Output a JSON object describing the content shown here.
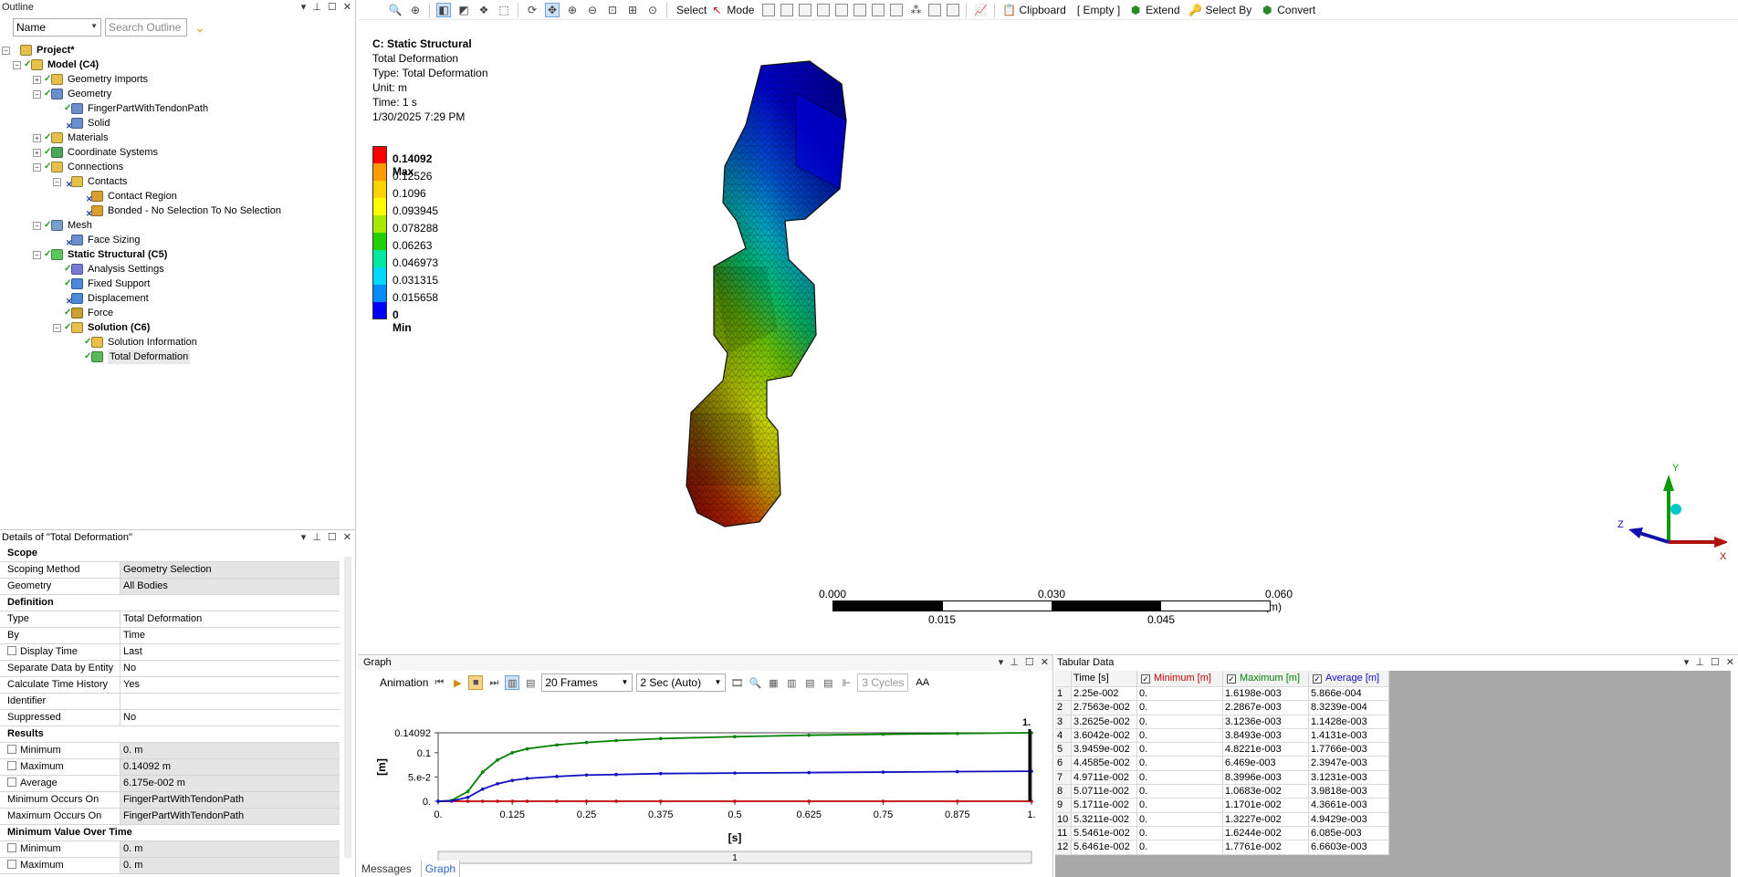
{
  "outline": {
    "title": "Outline",
    "name_filter": "Name",
    "search_placeholder": "Search Outline",
    "tree": [
      {
        "label": "Project*",
        "bold": true
      },
      {
        "label": "Model (C4)",
        "bold": true
      },
      {
        "label": "Geometry Imports"
      },
      {
        "label": "Geometry"
      },
      {
        "label": "FingerPartWithTendonPath"
      },
      {
        "label": "Solid"
      },
      {
        "label": "Materials"
      },
      {
        "label": "Coordinate Systems"
      },
      {
        "label": "Connections"
      },
      {
        "label": "Contacts"
      },
      {
        "label": "Contact Region"
      },
      {
        "label": "Bonded - No Selection To No Selection"
      },
      {
        "label": "Mesh"
      },
      {
        "label": "Face Sizing"
      },
      {
        "label": "Static Structural (C5)",
        "bold": true
      },
      {
        "label": "Analysis Settings"
      },
      {
        "label": "Fixed Support"
      },
      {
        "label": "Displacement"
      },
      {
        "label": "Force"
      },
      {
        "label": "Solution (C6)",
        "bold": true
      },
      {
        "label": "Solution Information"
      },
      {
        "label": "Total Deformation"
      }
    ]
  },
  "details": {
    "title": "Details of \"Total Deformation\"",
    "rows": [
      {
        "section": "Scope"
      },
      {
        "key": "Scoping Method",
        "value": "Geometry Selection",
        "gray": true
      },
      {
        "key": "Geometry",
        "value": "All Bodies",
        "gray": true
      },
      {
        "section": "Definition"
      },
      {
        "key": "Type",
        "value": "Total Deformation"
      },
      {
        "key": "By",
        "value": "Time"
      },
      {
        "key": "Display Time",
        "value": "Last",
        "checkbox": true
      },
      {
        "key": "Separate Data by Entity",
        "value": "No"
      },
      {
        "key": "Calculate Time History",
        "value": "Yes"
      },
      {
        "key": "Identifier",
        "value": ""
      },
      {
        "key": "Suppressed",
        "value": "No"
      },
      {
        "section": "Results"
      },
      {
        "key": "Minimum",
        "value": "0. m",
        "checkbox": true,
        "gray": true
      },
      {
        "key": "Maximum",
        "value": "0.14092 m",
        "checkbox": true,
        "gray": true
      },
      {
        "key": "Average",
        "value": "6.175e-002 m",
        "checkbox": true,
        "gray": true
      },
      {
        "key": "Minimum Occurs On",
        "value": "FingerPartWithTendonPath",
        "gray": true
      },
      {
        "key": "Maximum Occurs On",
        "value": "FingerPartWithTendonPath",
        "gray": true
      },
      {
        "section": "Minimum Value Over Time"
      },
      {
        "key": "Minimum",
        "value": "0. m",
        "checkbox": true,
        "gray": true
      },
      {
        "key": "Maximum",
        "value": "0. m",
        "checkbox": true,
        "gray": true
      }
    ]
  },
  "toolbar": {
    "select": "Select",
    "mode": "Mode",
    "clipboard": "Clipboard",
    "empty": "[ Empty ]",
    "extend": "Extend",
    "select_by": "Select By",
    "convert": "Convert"
  },
  "viewport": {
    "title": "C: Static Structural",
    "line1": "Total Deformation",
    "line2": "Type: Total Deformation",
    "line3": "Unit: m",
    "line4": "Time: 1 s",
    "line5": "1/30/2025 7:29 PM",
    "legend": [
      {
        "label": "0.14092 Max",
        "color": "#ff0000",
        "bold": true
      },
      {
        "label": "0.12526",
        "color": "#ff9a00"
      },
      {
        "label": "0.1096",
        "color": "#ffd200"
      },
      {
        "label": "0.093945",
        "color": "#ffff00"
      },
      {
        "label": "0.078288",
        "color": "#a8e800"
      },
      {
        "label": "0.06263",
        "color": "#20d000"
      },
      {
        "label": "0.046973",
        "color": "#00e8a0"
      },
      {
        "label": "0.031315",
        "color": "#00d8ff"
      },
      {
        "label": "0.015658",
        "color": "#008cff"
      },
      {
        "label": "0 Min",
        "color": "#0000ff",
        "bold": true
      }
    ],
    "scale_top": [
      "0.000",
      "0.030",
      "0.060 (m)"
    ],
    "scale_bottom": [
      "0.015",
      "0.045"
    ],
    "axis_x": "X",
    "axis_y": "Y",
    "axis_z": "Z"
  },
  "graph": {
    "title": "Graph",
    "animation": "Animation",
    "frames": "20 Frames",
    "duration": "2 Sec (Auto)",
    "cycles": "3 Cycles",
    "aa": "AA",
    "y_unit": "[m]",
    "x_unit": "[s]",
    "end_marker": "1.",
    "slider_value": "1",
    "tabs": [
      "Messages",
      "Graph"
    ]
  },
  "chart_data": {
    "type": "line",
    "xlabel": "[s]",
    "ylabel": "[m]",
    "xlim": [
      0,
      1
    ],
    "ylim": [
      0,
      0.14092
    ],
    "x_ticks": [
      "0.",
      "0.125",
      "0.25",
      "0.375",
      "0.5",
      "0.625",
      "0.75",
      "0.875",
      "1."
    ],
    "y_ticks": [
      "0.",
      "5.e-2",
      "0.1",
      "0.14092"
    ],
    "x": [
      0,
      0.0225,
      0.05,
      0.075,
      0.1,
      0.125,
      0.15,
      0.2,
      0.25,
      0.3,
      0.375,
      0.5,
      0.625,
      0.75,
      0.875,
      1.0
    ],
    "series": [
      {
        "name": "Minimum [m]",
        "color": "#c00000",
        "values": [
          0,
          0,
          0,
          0,
          0,
          0,
          0,
          0,
          0,
          0,
          0,
          0,
          0,
          0,
          0,
          0
        ]
      },
      {
        "name": "Maximum [m]",
        "color": "#008000",
        "values": [
          0,
          0.0016,
          0.02,
          0.06,
          0.085,
          0.1,
          0.108,
          0.116,
          0.121,
          0.125,
          0.129,
          0.133,
          0.136,
          0.138,
          0.1395,
          0.14092
        ]
      },
      {
        "name": "Average [m]",
        "color": "#1010c0",
        "values": [
          0,
          0.0006,
          0.008,
          0.025,
          0.036,
          0.043,
          0.047,
          0.051,
          0.054,
          0.055,
          0.057,
          0.058,
          0.059,
          0.06,
          0.061,
          0.06175
        ]
      }
    ]
  },
  "tabular": {
    "title": "Tabular Data",
    "headers": [
      "Time [s]",
      "Minimum [m]",
      "Maximum [m]",
      "Average [m]"
    ],
    "header_colors": [
      "#000000",
      "#c00000",
      "#008000",
      "#1010c0"
    ],
    "rows": [
      [
        "1",
        "2.25e-002",
        "0.",
        "1.6198e-003",
        "5.866e-004"
      ],
      [
        "2",
        "2.7563e-002",
        "0.",
        "2.2867e-003",
        "8.3239e-004"
      ],
      [
        "3",
        "3.2625e-002",
        "0.",
        "3.1236e-003",
        "1.1428e-003"
      ],
      [
        "4",
        "3.6042e-002",
        "0.",
        "3.8493e-003",
        "1.4131e-003"
      ],
      [
        "5",
        "3.9459e-002",
        "0.",
        "4.8221e-003",
        "1.7766e-003"
      ],
      [
        "6",
        "4.4585e-002",
        "0.",
        "6.469e-003",
        "2.3947e-003"
      ],
      [
        "7",
        "4.9711e-002",
        "0.",
        "8.3996e-003",
        "3.1231e-003"
      ],
      [
        "8",
        "5.0711e-002",
        "0.",
        "1.0683e-002",
        "3.9818e-003"
      ],
      [
        "9",
        "5.1711e-002",
        "0.",
        "1.1701e-002",
        "4.3661e-003"
      ],
      [
        "10",
        "5.3211e-002",
        "0.",
        "1.3227e-002",
        "4.9429e-003"
      ],
      [
        "11",
        "5.5461e-002",
        "0.",
        "1.6244e-002",
        "6.085e-003"
      ],
      [
        "12",
        "5.6461e-002",
        "0.",
        "1.7761e-002",
        "6.6603e-003"
      ]
    ]
  }
}
